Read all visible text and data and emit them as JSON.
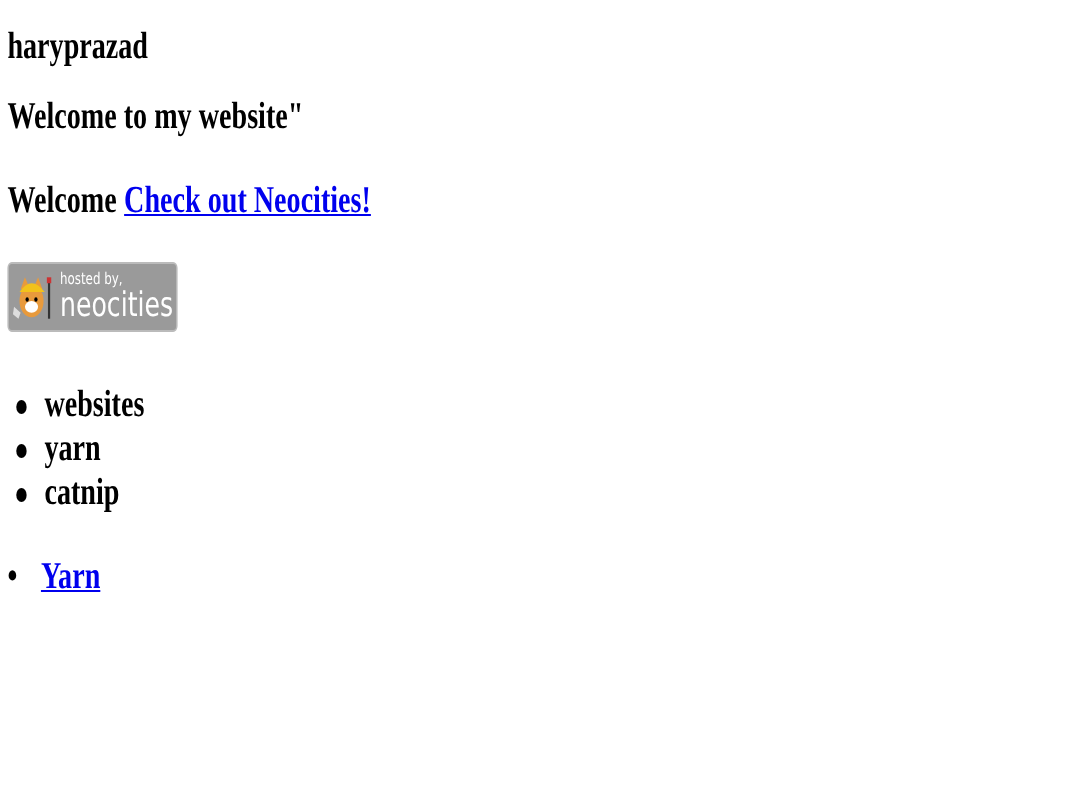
{
  "title": "haryprazad",
  "heading": "Welcome to my website\"",
  "welcome": {
    "text": "Welcome",
    "link": "Check out Neocities!"
  },
  "badge": {
    "line_1": "hosted by,",
    "line_2": "neocities"
  },
  "list": [
    "websites",
    "yarn",
    "catnip"
  ],
  "links": [
    {
      "bullet": "•",
      "label": "Yarn"
    }
  ]
}
